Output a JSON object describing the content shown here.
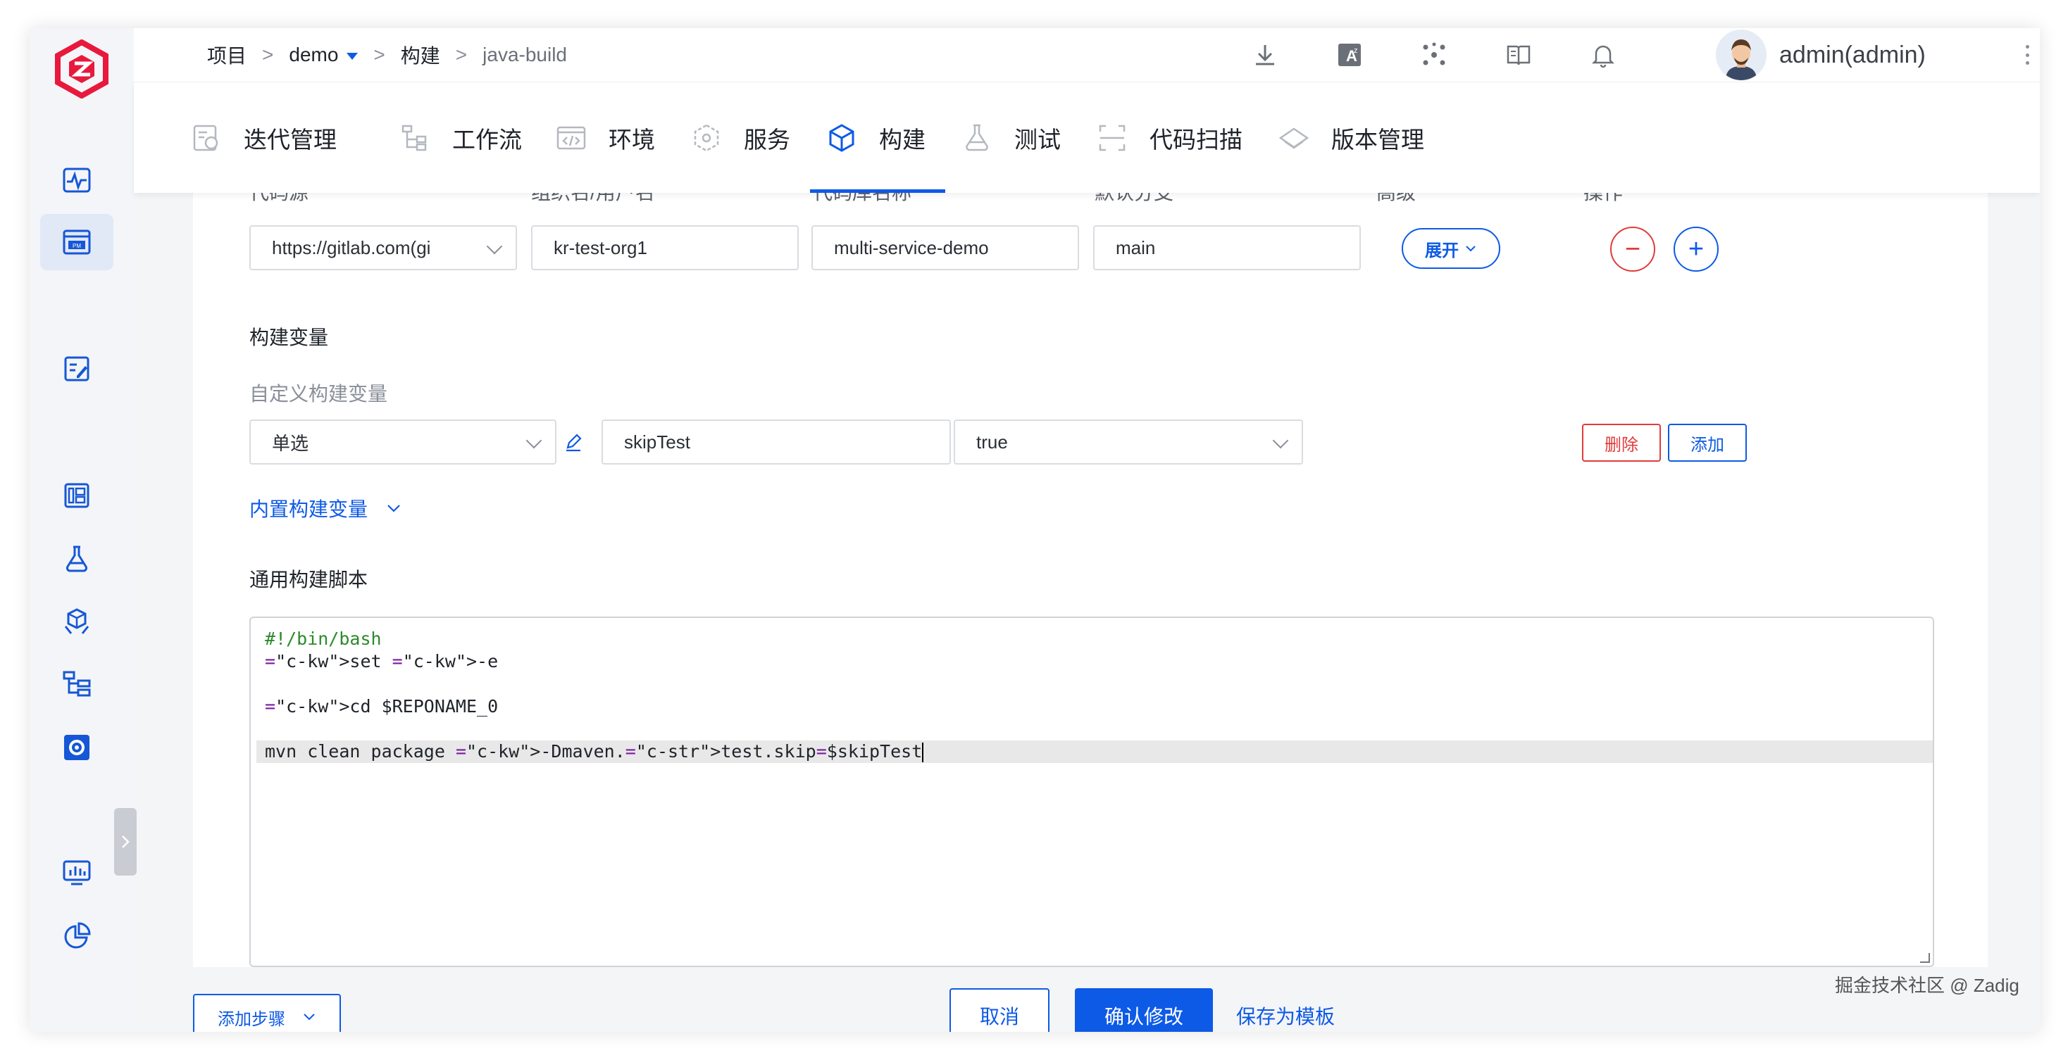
{
  "breadcrumb": {
    "items": [
      "项目",
      "demo",
      "构建",
      "java-build"
    ],
    "separator": ">"
  },
  "header": {
    "icons": [
      "download-icon",
      "translate-icon",
      "share-network-icon",
      "book-icon",
      "bell-icon"
    ],
    "user_name": "admin(admin)"
  },
  "sidebar": {
    "icons": [
      "logo-icon",
      "pulse-monitor-icon",
      "pm-project-icon",
      "edit-note-icon",
      "dashboard-icon",
      "flask-icon",
      "hands-cube-icon",
      "tree-structure-icon",
      "gear-box-icon",
      "monitor-chart-icon",
      "pie-chart-icon"
    ]
  },
  "nav": {
    "tabs": [
      {
        "label": "迭代管理",
        "icon": "iteration-icon"
      },
      {
        "label": "工作流",
        "icon": "workflow-icon"
      },
      {
        "label": "环境",
        "icon": "environment-icon"
      },
      {
        "label": "服务",
        "icon": "service-icon"
      },
      {
        "label": "构建",
        "icon": "build-cube-icon"
      },
      {
        "label": "测试",
        "icon": "test-flask-icon"
      },
      {
        "label": "代码扫描",
        "icon": "scan-icon"
      },
      {
        "label": "版本管理",
        "icon": "version-icon"
      }
    ],
    "active": "构建"
  },
  "repo": {
    "columns": [
      "代码源",
      "组织名/用户名",
      "代码库名称",
      "默认分支",
      "高级",
      "操作"
    ],
    "source": "https://gitlab.com(gi",
    "org": "kr-test-org1",
    "repo_name": "multi-service-demo",
    "branch": "main",
    "expand_label": "展开",
    "remove_symbol": "−",
    "add_symbol": "+"
  },
  "build_vars": {
    "title": "构建变量",
    "custom_title": "自定义构建变量",
    "type": "单选",
    "key": "skipTest",
    "value": "true",
    "delete_label": "删除",
    "add_label": "添加",
    "builtin_label": "内置构建变量"
  },
  "script": {
    "title": "通用构建脚本",
    "lines": [
      "#!/bin/bash",
      "set -e",
      "",
      "cd $REPONAME_0",
      "",
      "mvn clean package -Dmaven.test.skip=$skipTest"
    ]
  },
  "footer": {
    "add_step_label": "添加步骤",
    "cancel_label": "取消",
    "confirm_label": "确认修改",
    "save_template_label": "保存为模板"
  },
  "watermark": "掘金技术社区 @ Zadig",
  "colors": {
    "primary": "#0d5ae6",
    "danger": "#e13b3b",
    "logo": "#e8193c"
  }
}
